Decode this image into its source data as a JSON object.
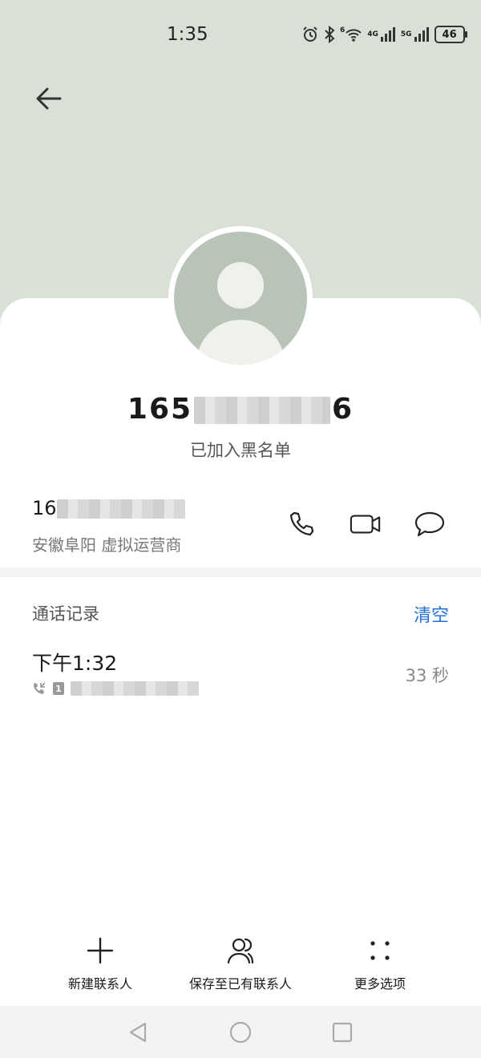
{
  "status_bar": {
    "time": "1:35",
    "battery": "46",
    "net_4g": "4G",
    "net_5g": "5G",
    "wifi_sup": "6"
  },
  "contact": {
    "name_visible_prefix": "165",
    "name_visible_suffix": "6",
    "blocked_text": "已加入黑名单",
    "number_visible_prefix": "16",
    "location_text": "安徽阜阳 虚拟运营商"
  },
  "call_log": {
    "title": "通话记录",
    "clear_label": "清空",
    "entries": [
      {
        "time": "下午1:32",
        "sim": "1",
        "duration": "33 秒"
      }
    ]
  },
  "bottom_actions": {
    "new_contact": "新建联系人",
    "save_existing": "保存至已有联系人",
    "more_options": "更多选项"
  },
  "icons": {
    "back": "back-arrow-icon",
    "call": "phone-icon",
    "video": "video-call-icon",
    "message": "message-icon",
    "add": "plus-icon",
    "person": "person-icon",
    "more": "dots-icon"
  },
  "colors": {
    "hero": "#d9e1d7",
    "accent": "#1f6fd4",
    "avatar": "#b8c4b6"
  }
}
